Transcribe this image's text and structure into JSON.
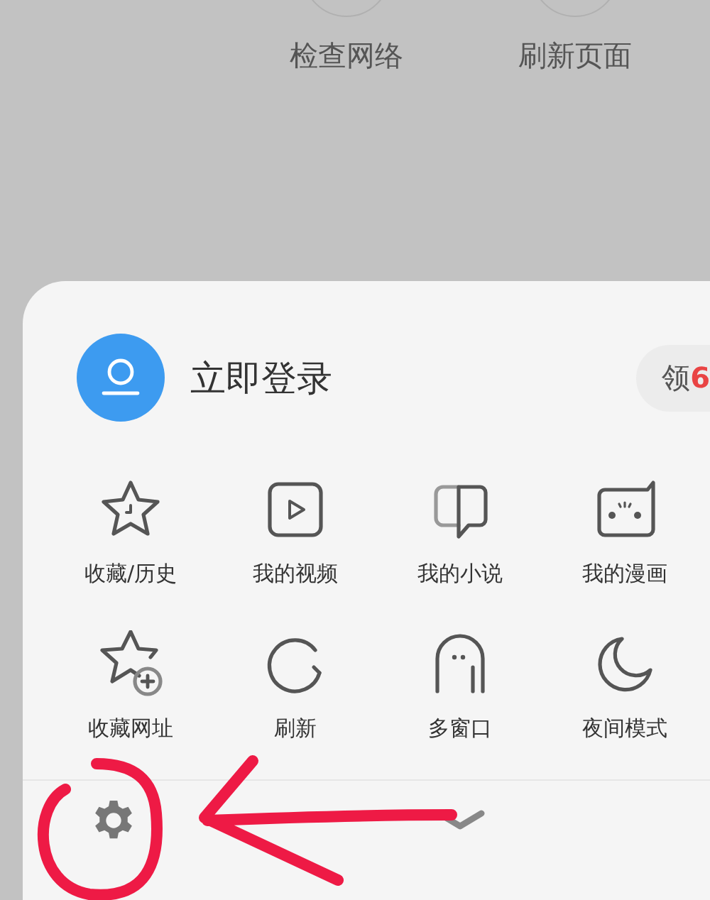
{
  "top_actions": [
    {
      "label": "检查网络"
    },
    {
      "label": "刷新页面"
    }
  ],
  "account": {
    "login_label": "立即登录",
    "promo": {
      "prefix": "领",
      "amount": "6"
    }
  },
  "menu_items": [
    {
      "kind": "favorites",
      "label": "收藏/历史"
    },
    {
      "kind": "video",
      "label": "我的视频"
    },
    {
      "kind": "novel",
      "label": "我的小说"
    },
    {
      "kind": "comic",
      "label": "我的漫画"
    },
    {
      "kind": "bookmark-add",
      "label": "收藏网址"
    },
    {
      "kind": "refresh",
      "label": "刷新"
    },
    {
      "kind": "windows",
      "label": "多窗口"
    },
    {
      "kind": "night",
      "label": "夜间模式"
    }
  ]
}
